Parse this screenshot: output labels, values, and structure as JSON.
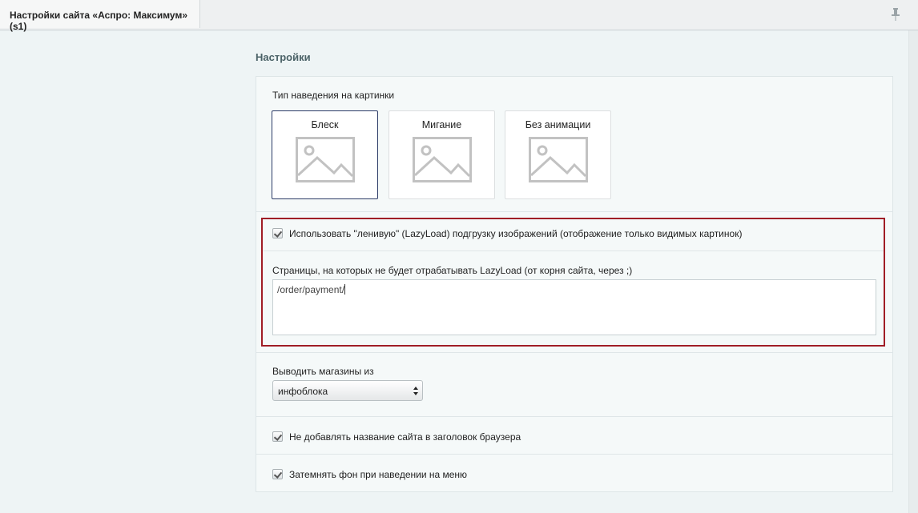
{
  "tab": {
    "title": "Настройки сайта «Аспро: Максимум» (s1)"
  },
  "section": {
    "title": "Настройки"
  },
  "hover": {
    "label": "Тип наведения на картинки",
    "options": [
      "Блеск",
      "Мигание",
      "Без анимации"
    ],
    "selected": "Блеск"
  },
  "lazyload": {
    "checkbox_label": "Использовать \"ленивую\" (LazyLoad) подгрузку изображений (отображение только видимых картинок)",
    "checked": true,
    "pages_label": "Страницы, на которых не будет отрабатывать LazyLoad (от корня сайта, через ;)",
    "pages_value": "/order/payment/"
  },
  "stores": {
    "label": "Выводить магазины из",
    "value": "инфоблока"
  },
  "no_site_name": {
    "label": "Не добавлять название сайта в заголовок браузера",
    "checked": true
  },
  "darken_menu": {
    "label": "Затемнять фон при наведении на меню",
    "checked": true
  },
  "colors": {
    "highlight_border": "#a01d26",
    "selected_card_border": "#2b3a66",
    "heading": "#4b6267"
  }
}
